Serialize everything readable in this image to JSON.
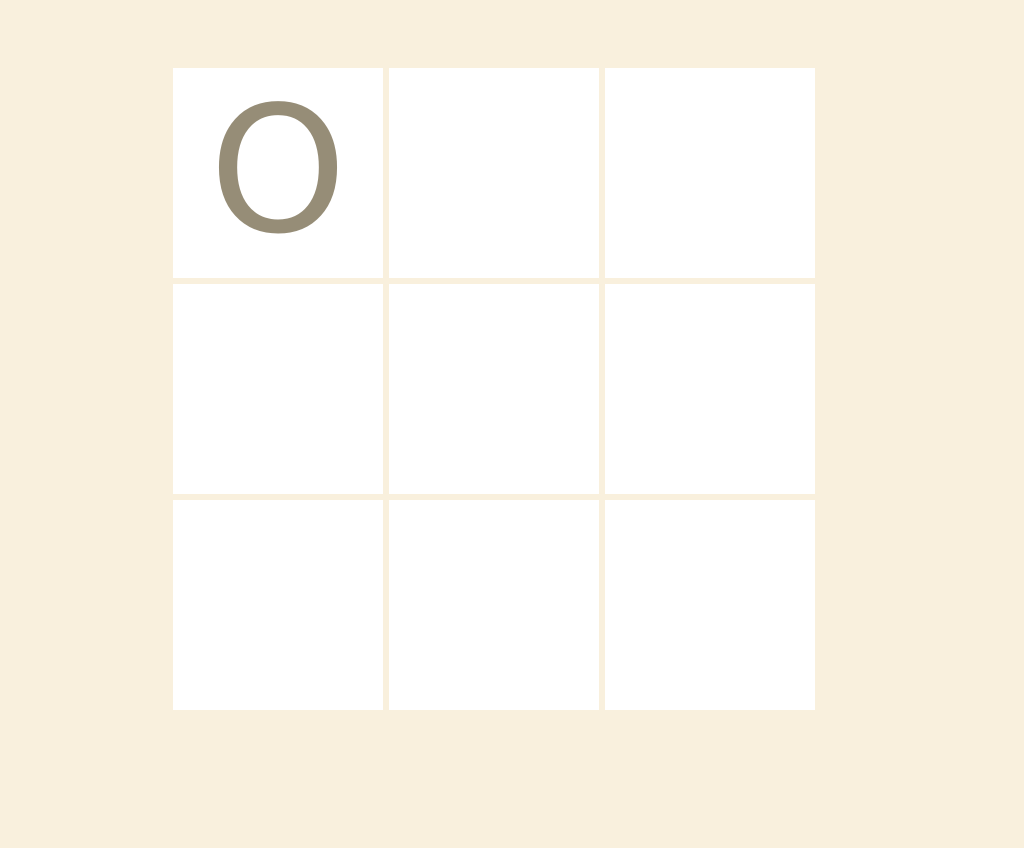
{
  "board": {
    "cells": [
      "O",
      "",
      "",
      "",
      "",
      "",
      "",
      "",
      ""
    ]
  },
  "colors": {
    "background": "#f9f0dd",
    "cell": "#ffffff",
    "mark": "#968d77"
  }
}
